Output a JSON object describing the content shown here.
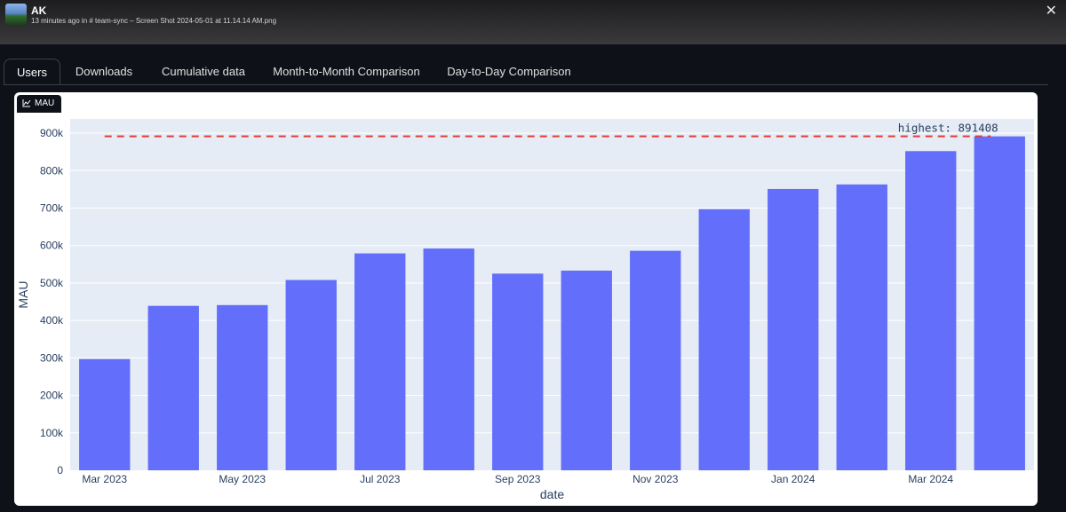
{
  "post": {
    "author": "AK",
    "meta": "13 minutes ago in # team-sync  – Screen Shot 2024-05-01 at 11.14.14 AM.png",
    "close_label": "✕"
  },
  "tabs": [
    {
      "label": "Users",
      "active": true
    },
    {
      "label": "Downloads",
      "active": false
    },
    {
      "label": "Cumulative data",
      "active": false
    },
    {
      "label": "Month-to-Month Comparison",
      "active": false
    },
    {
      "label": "Day-to-Day Comparison",
      "active": false
    }
  ],
  "chip_label": "MAU",
  "colors": {
    "bar": "#636efa",
    "plot_bg": "#e5ecf6",
    "line": "#e53935",
    "axis_text": "#2a3f5f"
  },
  "chart_data": {
    "type": "bar",
    "categories": [
      "2023-03",
      "2023-04",
      "2023-05",
      "2023-06",
      "2023-07",
      "2023-08",
      "2023-09",
      "2023-10",
      "2023-11",
      "2023-12",
      "2024-01",
      "2024-02",
      "2024-03",
      "2024-04"
    ],
    "values": [
      297000,
      439000,
      441000,
      508000,
      579000,
      592000,
      525000,
      533000,
      586000,
      697000,
      751000,
      763000,
      852000,
      891408
    ],
    "x_tick_labels": [
      "Mar 2023",
      "May 2023",
      "Jul 2023",
      "Sep 2023",
      "Nov 2023",
      "Jan 2024",
      "Mar 2024"
    ],
    "x_tick_category_index": [
      0,
      2,
      4,
      6,
      8,
      10,
      12
    ],
    "y_ticks": [
      0,
      100000,
      200000,
      300000,
      400000,
      500000,
      600000,
      700000,
      800000,
      900000
    ],
    "y_tick_labels": [
      "0",
      "100k",
      "200k",
      "300k",
      "400k",
      "500k",
      "600k",
      "700k",
      "800k",
      "900k"
    ],
    "ylim": [
      0,
      938000
    ],
    "xlabel": "date",
    "ylabel": "MAU",
    "grid": true,
    "reference_line": {
      "value": 891408,
      "label": "highest: 891408",
      "style": "dashed"
    }
  }
}
